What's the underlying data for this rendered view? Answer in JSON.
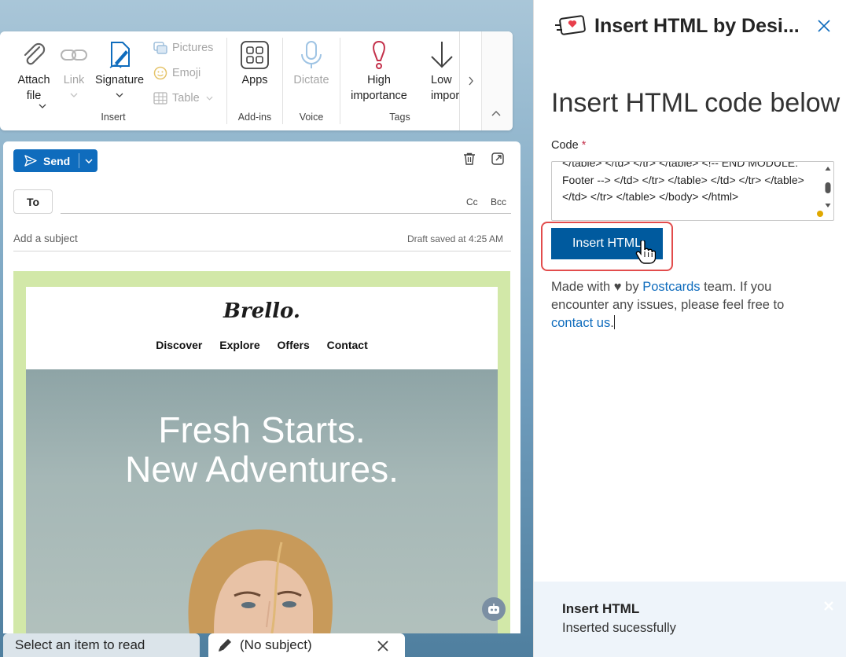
{
  "ribbon": {
    "insert_group": {
      "label": "Insert",
      "attach_file": "Attach\nfile",
      "link": "Link",
      "signature": "Signature",
      "pictures": "Pictures",
      "emoji": "Emoji",
      "table": "Table"
    },
    "addins_group": {
      "label": "Add-ins",
      "apps": "Apps"
    },
    "voice_group": {
      "label": "Voice",
      "dictate": "Dictate"
    },
    "tags_group": {
      "label": "Tags",
      "high_importance": "High\nimportance",
      "low_importance": "Low\nimportan"
    }
  },
  "compose": {
    "send_label": "Send",
    "to_label": "To",
    "cc_label": "Cc",
    "bcc_label": "Bcc",
    "subject_placeholder": "Add a subject",
    "draft_status": "Draft saved at 4:25 AM"
  },
  "email": {
    "brand": "Brello.",
    "nav": [
      "Discover",
      "Explore",
      "Offers",
      "Contact"
    ],
    "hero_line1": "Fresh Starts.",
    "hero_line2": "New Adventures."
  },
  "taskbar": {
    "read_tab": "Select an item to read",
    "draft_tab": "(No subject)"
  },
  "addin": {
    "title": "Insert HTML by Desi...",
    "heading": "Insert HTML code below",
    "code_label": "Code",
    "required_mark": "*",
    "code_value": "</table> </td> </tr> </table> <!-- END MODULE: Footer --> </td> </tr> </table> </td> </tr> </table> </td> </tr> </table> </body> </html>",
    "insert_button": "Insert HTML",
    "made_with_prefix": "Made with ♥ by ",
    "made_with_link": "Postcards",
    "made_with_middle": " team. If you encounter any issues, please feel free to ",
    "contact_link": "contact us",
    "made_with_end": ".",
    "notification_title": "Insert HTML",
    "notification_message": "Inserted sucessfully"
  },
  "colors": {
    "accent": "#0f6cbd",
    "insert_button": "#005a9e",
    "highlight": "#e24c4c",
    "email_frame": "#d2e8a8",
    "notification_bg": "#eef4fa"
  }
}
